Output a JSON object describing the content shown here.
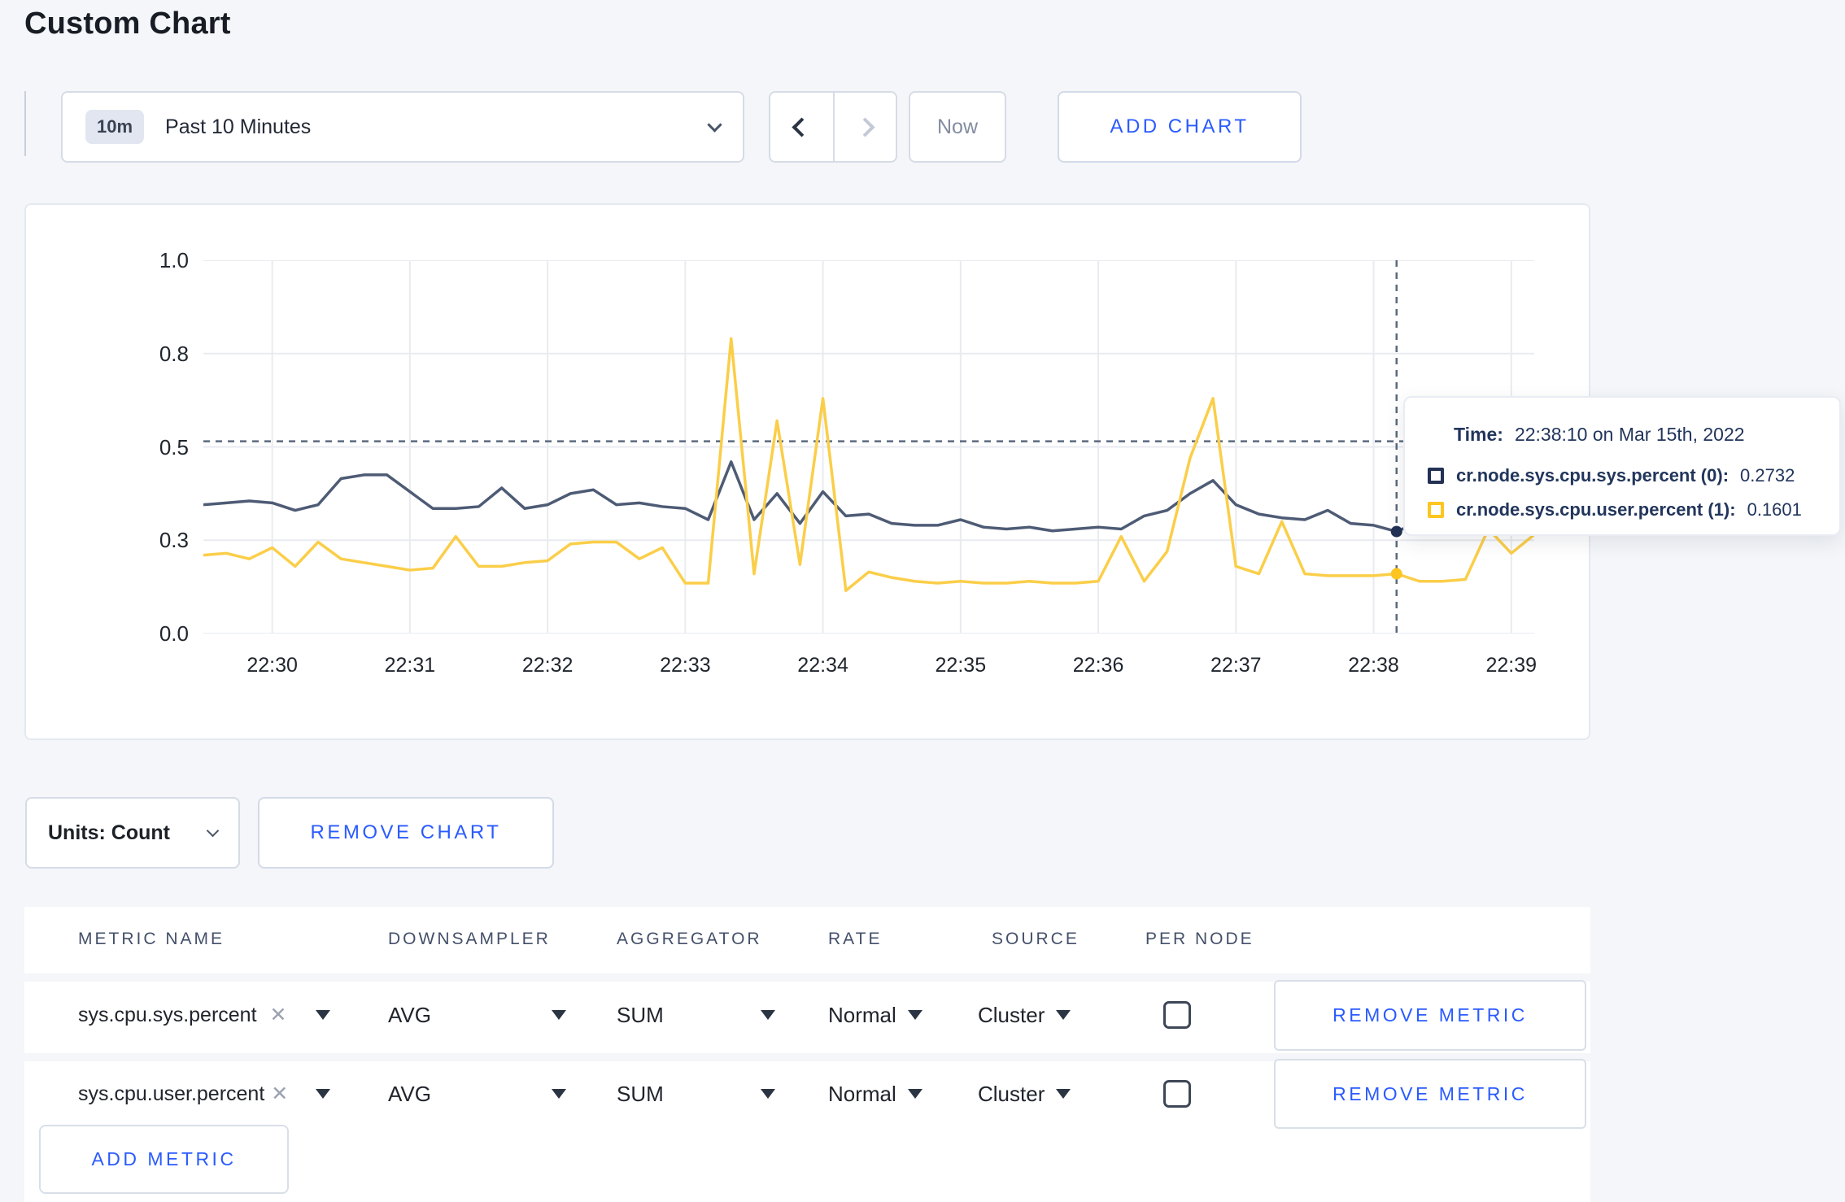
{
  "page": {
    "title": "Custom Chart"
  },
  "toolbar": {
    "time_badge": "10m",
    "time_label": "Past 10 Minutes",
    "prev_icon": "chevron-left",
    "next_icon": "chevron-right",
    "now": "Now",
    "add_chart": "ADD CHART"
  },
  "chart_data": {
    "type": "line",
    "title": "",
    "xlabel": "",
    "ylabel": "",
    "ylim": [
      0,
      1.0
    ],
    "grid": true,
    "legend_position": "tooltip-overlay",
    "x_start": "22:29:30",
    "x_step_seconds": 10,
    "x_domain_seconds": [
      0,
      580
    ],
    "x_ticks": [
      {
        "t": 30,
        "label": "22:30"
      },
      {
        "t": 90,
        "label": "22:31"
      },
      {
        "t": 150,
        "label": "22:32"
      },
      {
        "t": 210,
        "label": "22:33"
      },
      {
        "t": 270,
        "label": "22:34"
      },
      {
        "t": 330,
        "label": "22:35"
      },
      {
        "t": 390,
        "label": "22:36"
      },
      {
        "t": 450,
        "label": "22:37"
      },
      {
        "t": 510,
        "label": "22:38"
      },
      {
        "t": 570,
        "label": "22:39"
      }
    ],
    "y_ticks": [
      {
        "v": 1.0,
        "label": "1.0"
      },
      {
        "v": 0.75,
        "label": "0.8"
      },
      {
        "v": 0.5,
        "label": "0.5"
      },
      {
        "v": 0.25,
        "label": "0.3"
      },
      {
        "v": 0.0,
        "label": "0.0"
      }
    ],
    "series": [
      {
        "name": "cr.node.sys.cpu.sys.percent (0)",
        "color": "#4e5b75",
        "dot_color": "#223154",
        "values": [
          0.345,
          0.35,
          0.355,
          0.35,
          0.33,
          0.345,
          0.415,
          0.425,
          0.425,
          0.38,
          0.335,
          0.335,
          0.34,
          0.39,
          0.335,
          0.345,
          0.375,
          0.385,
          0.345,
          0.35,
          0.34,
          0.335,
          0.305,
          0.46,
          0.305,
          0.375,
          0.295,
          0.38,
          0.315,
          0.32,
          0.295,
          0.29,
          0.29,
          0.305,
          0.285,
          0.28,
          0.285,
          0.275,
          0.28,
          0.285,
          0.28,
          0.315,
          0.33,
          0.375,
          0.41,
          0.345,
          0.32,
          0.31,
          0.305,
          0.33,
          0.295,
          0.29,
          0.2732,
          0.3,
          0.295,
          0.285,
          0.28,
          0.3,
          0.315
        ]
      },
      {
        "name": "cr.node.sys.cpu.user.percent (1)",
        "color": "#fbce49",
        "dot_color": "#fdc51f",
        "values": [
          0.21,
          0.215,
          0.2,
          0.23,
          0.18,
          0.245,
          0.2,
          0.19,
          0.18,
          0.17,
          0.175,
          0.26,
          0.18,
          0.18,
          0.19,
          0.195,
          0.24,
          0.245,
          0.245,
          0.2,
          0.23,
          0.135,
          0.135,
          0.79,
          0.16,
          0.57,
          0.185,
          0.63,
          0.115,
          0.165,
          0.15,
          0.14,
          0.135,
          0.14,
          0.135,
          0.135,
          0.14,
          0.135,
          0.135,
          0.14,
          0.26,
          0.14,
          0.22,
          0.47,
          0.63,
          0.18,
          0.16,
          0.3,
          0.16,
          0.155,
          0.155,
          0.155,
          0.1601,
          0.14,
          0.14,
          0.145,
          0.28,
          0.215,
          0.265
        ]
      }
    ],
    "crosshair": {
      "t": 520,
      "guideline_value": 0.515
    },
    "grid_color": "#e9ebf0",
    "crosshair_color": "#5b6a7d"
  },
  "tooltip": {
    "time_label": "Time:",
    "time_value": "22:38:10 on Mar 15th, 2022",
    "series": [
      {
        "swatch": "#223154",
        "label": "cr.node.sys.cpu.sys.percent (0):",
        "value": "0.2732"
      },
      {
        "swatch": "#fdc51f",
        "label": "cr.node.sys.cpu.user.percent (1):",
        "value": "0.1601"
      }
    ]
  },
  "chart_footer": {
    "units": "Units: Count",
    "remove_chart": "REMOVE CHART"
  },
  "metrics_table": {
    "headers": [
      "METRIC NAME",
      "DOWNSAMPLER",
      "AGGREGATOR",
      "RATE",
      "SOURCE",
      "PER NODE"
    ],
    "rows": [
      {
        "metric_name": "sys.cpu.sys.percent",
        "downsampler": "AVG",
        "aggregator": "SUM",
        "rate": "Normal",
        "source": "Cluster",
        "per_node_checked": false,
        "remove_label": "REMOVE METRIC"
      },
      {
        "metric_name": "sys.cpu.user.percent",
        "downsampler": "AVG",
        "aggregator": "SUM",
        "rate": "Normal",
        "source": "Cluster",
        "per_node_checked": false,
        "remove_label": "REMOVE METRIC"
      }
    ],
    "add_metric": "ADD METRIC"
  }
}
